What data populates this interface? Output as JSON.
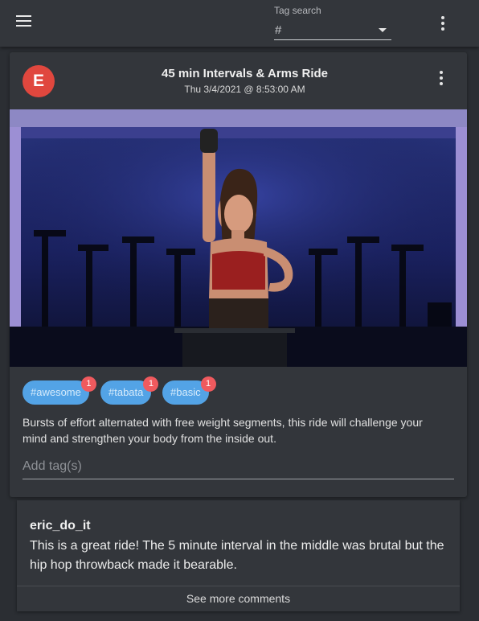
{
  "appbar": {
    "menu_icon": "hamburger-menu-icon",
    "tag_search": {
      "label": "Tag search",
      "placeholder": "#",
      "value": ""
    },
    "more_icon": "more-vert-icon"
  },
  "post": {
    "avatar_letter": "E",
    "avatar_color": "#e0473e",
    "title": "45 min Intervals & Arms Ride",
    "subtitle": "Thu 3/4/2021 @ 8:53:00 AM",
    "more_icon": "more-vert-icon",
    "tags": [
      {
        "label": "#awesome",
        "count": "1"
      },
      {
        "label": "#tabata",
        "count": "1"
      },
      {
        "label": "#basic",
        "count": "1"
      }
    ],
    "description": "Bursts of effort alternated with free weight segments, this ride will challenge your mind and strengthen your body from the inside out.",
    "add_tag_placeholder": "Add tag(s)"
  },
  "comments": {
    "author": "eric_do_it",
    "text": "This is a great ride! The 5 minute interval in the middle was brutal but the hip hop throwback made it bearable.",
    "see_more": "See more comments"
  },
  "colors": {
    "chip": "#53a3e6",
    "badge": "#ef5a5e",
    "surface": "#33363b",
    "background": "#2b2e33"
  }
}
